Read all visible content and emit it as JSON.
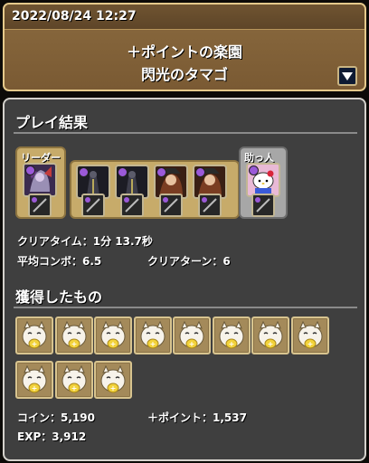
{
  "header": {
    "datetime": "2022/08/24 12:27",
    "dungeon_name": "＋ポイントの楽園",
    "floor_name": "閃光のタマゴ"
  },
  "result": {
    "section_title": "プレイ結果",
    "leader_tag": "リーダー",
    "helper_tag": "助っ人",
    "clear_time_label": "クリアタイム：",
    "clear_time_value": "1分 13.7秒",
    "avg_combo_label": "平均コンボ：",
    "avg_combo_value": "6.5",
    "clear_turns_label": "クリアターン：",
    "clear_turns_value": "6"
  },
  "team": {
    "leader": {
      "attribute": "purple-dark",
      "orb": "#9b59d8",
      "assist": "dark-slot"
    },
    "subs": [
      {
        "attribute": "dark",
        "orb": "#9b59d8",
        "assist": "dark-slot"
      },
      {
        "attribute": "dark",
        "orb": "#9b59d8",
        "assist": "dark-slot"
      },
      {
        "attribute": "fire",
        "orb": "#9b59d8",
        "assist": "dark-slot"
      },
      {
        "attribute": "fire",
        "orb": "#9b59d8",
        "assist": "dark-slot"
      }
    ],
    "helper": {
      "attribute": "pink",
      "orb": "#9b59d8",
      "assist": "dark-slot"
    }
  },
  "drops": {
    "section_title": "獲得したもの",
    "count": 11,
    "item": "tamago-plus-icon"
  },
  "rewards": {
    "coin_label": "コイン：",
    "coin_value": "5,190",
    "plus_label": "＋ポイント：",
    "plus_value": "1,537",
    "exp_label": "EXP：",
    "exp_value": "3,912"
  }
}
